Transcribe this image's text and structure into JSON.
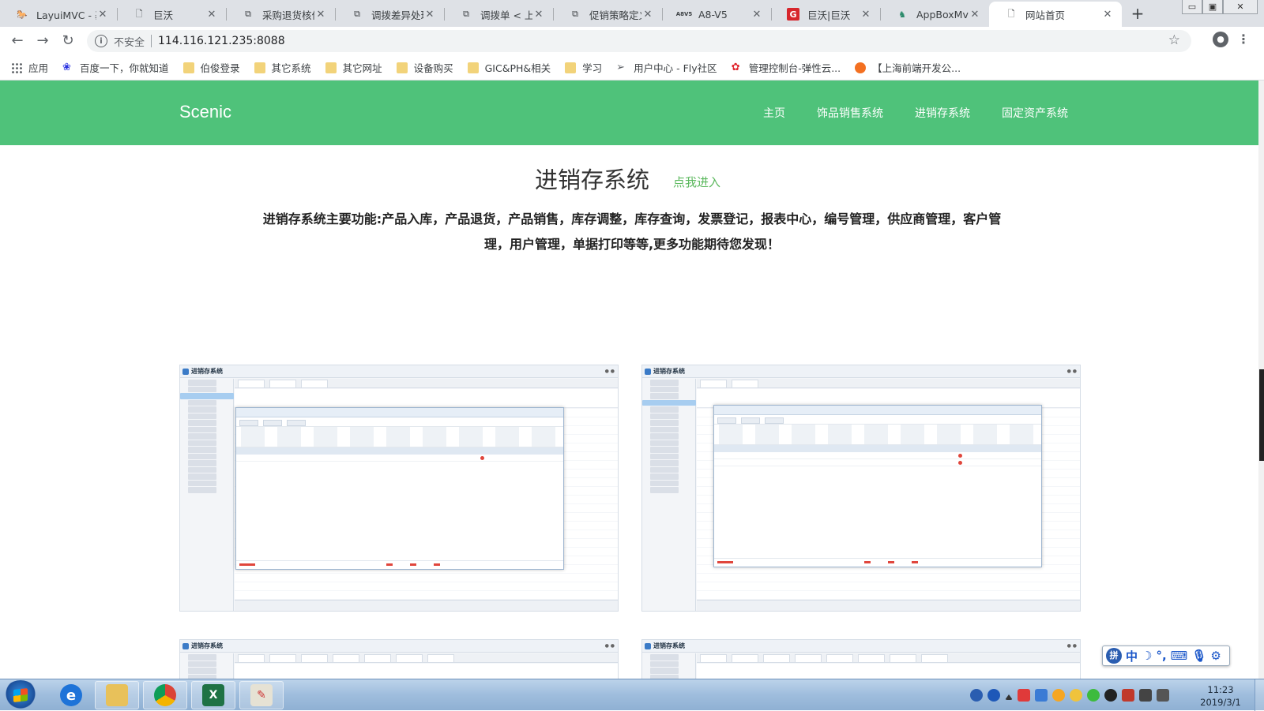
{
  "browser": {
    "tabs": [
      {
        "title": "LayuiMVC - 基",
        "icon": "horse-icon"
      },
      {
        "title": "巨沃",
        "icon": "page-icon"
      },
      {
        "title": "采购退货核价",
        "icon": "copy-icon"
      },
      {
        "title": "调拨差异处理",
        "icon": "copy-icon"
      },
      {
        "title": "调拨单 < 上海",
        "icon": "copy-icon"
      },
      {
        "title": "促销策略定义",
        "icon": "copy-icon"
      },
      {
        "title": "A8-V5",
        "icon": "a8-icon"
      },
      {
        "title": "巨沃|巨沃",
        "icon": "g-icon"
      },
      {
        "title": "AppBoxMvc -",
        "icon": "appbox-icon"
      },
      {
        "title": "网站首页",
        "icon": "page-icon"
      }
    ],
    "new_tab": "+",
    "window_buttons": {
      "minimize": "▭",
      "restore": "▣",
      "close": "✕"
    },
    "security_label": "不安全",
    "url": "114.116.121.235:8088",
    "bookmarks": [
      {
        "label": "应用",
        "icon": "apps-grid-icon"
      },
      {
        "label": "百度一下，你就知道",
        "icon": "baidu-paw-icon"
      },
      {
        "label": "伯俊登录",
        "icon": "folder-icon"
      },
      {
        "label": "其它系统",
        "icon": "folder-icon"
      },
      {
        "label": "其它网址",
        "icon": "folder-icon"
      },
      {
        "label": "设备购买",
        "icon": "folder-icon"
      },
      {
        "label": "GIC&PH&相关",
        "icon": "folder-icon"
      },
      {
        "label": "学习",
        "icon": "folder-icon"
      },
      {
        "label": "用户中心 - Fly社区",
        "icon": "paper-plane-icon"
      },
      {
        "label": "管理控制台-弹性云...",
        "icon": "huawei-icon"
      },
      {
        "label": "【上海前端开发公...",
        "icon": "orange-circle-icon"
      }
    ]
  },
  "site": {
    "brand": "Scenic",
    "nav": [
      "主页",
      "饰品销售系统",
      "进销存系统",
      "固定资产系统"
    ],
    "section_title": "进销存系统",
    "enter_link": "点我进入",
    "description": "进销存系统主要功能:产品入库，产品退货，产品销售，库存调整，库存查询，发票登记，报表中心，编号管理，供应商管理，客户管理，用户管理，单据打印等等,更多功能期待您发现！",
    "screenshot_app_title": "进销存系统",
    "accent_color": "#4fc27a",
    "link_color": "#5bb85d"
  },
  "ime": {
    "label": "中",
    "logo": "拼"
  },
  "taskbar": {
    "apps": [
      "ie-icon",
      "explorer-folder-icon",
      "chrome-icon",
      "excel-icon",
      "paint-icon"
    ],
    "time": "11:23",
    "date": "2019/3/1"
  }
}
